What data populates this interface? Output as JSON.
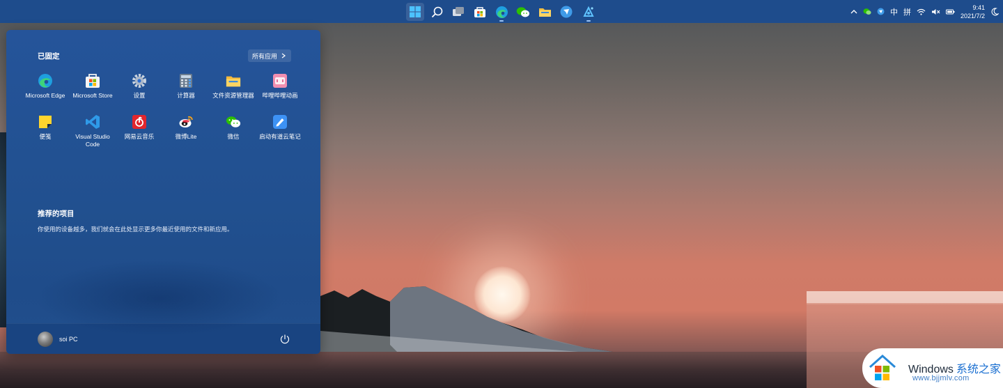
{
  "taskbar": {
    "apps": [
      {
        "icon": "windows-start-icon",
        "active": true
      },
      {
        "icon": "search-icon"
      },
      {
        "icon": "task-view-icon"
      },
      {
        "icon": "microsoft-store-icon"
      },
      {
        "icon": "edge-icon",
        "running": true
      },
      {
        "icon": "wechat-icon"
      },
      {
        "icon": "file-explorer-icon"
      },
      {
        "icon": "feishu-icon"
      },
      {
        "icon": "dev-tool-icon",
        "running": true
      }
    ],
    "tray": {
      "ime_mode": "中",
      "ime_name": "拼",
      "time": "9:41",
      "date": "2021/7/2"
    }
  },
  "start_menu": {
    "pinned_title": "已固定",
    "all_apps_label": "所有应用",
    "pinned_apps": [
      {
        "label": "Microsoft Edge",
        "icon": "edge-icon"
      },
      {
        "label": "Microsoft Store",
        "icon": "store-icon"
      },
      {
        "label": "设置",
        "icon": "settings-icon"
      },
      {
        "label": "计算器",
        "icon": "calculator-icon"
      },
      {
        "label": "文件资源管理器",
        "icon": "folder-icon"
      },
      {
        "label": "哔哩哔哩动画",
        "icon": "bilibili-icon"
      },
      {
        "label": "便笺",
        "icon": "sticky-notes-icon"
      },
      {
        "label": "Visual Studio Code",
        "icon": "vscode-icon"
      },
      {
        "label": "网易云音乐",
        "icon": "netease-music-icon"
      },
      {
        "label": "微博Lite",
        "icon": "weibo-icon"
      },
      {
        "label": "微信",
        "icon": "wechat-icon"
      },
      {
        "label": "启动有道云笔记",
        "icon": "youdao-note-icon"
      }
    ],
    "recommended_title": "推荐的项目",
    "recommended_desc": "你使用的设备越多，我们就会在此处显示更多你最近使用的文件和新应用。",
    "user_name": "soi PC"
  },
  "watermark": {
    "brand": "Windows",
    "brand_cn": "系统之家",
    "url": "www.bjjmlv.com"
  },
  "colors": {
    "taskbar": "#1e4c8c",
    "start_menu": "#23529a",
    "accent": "#1a6fd1"
  }
}
